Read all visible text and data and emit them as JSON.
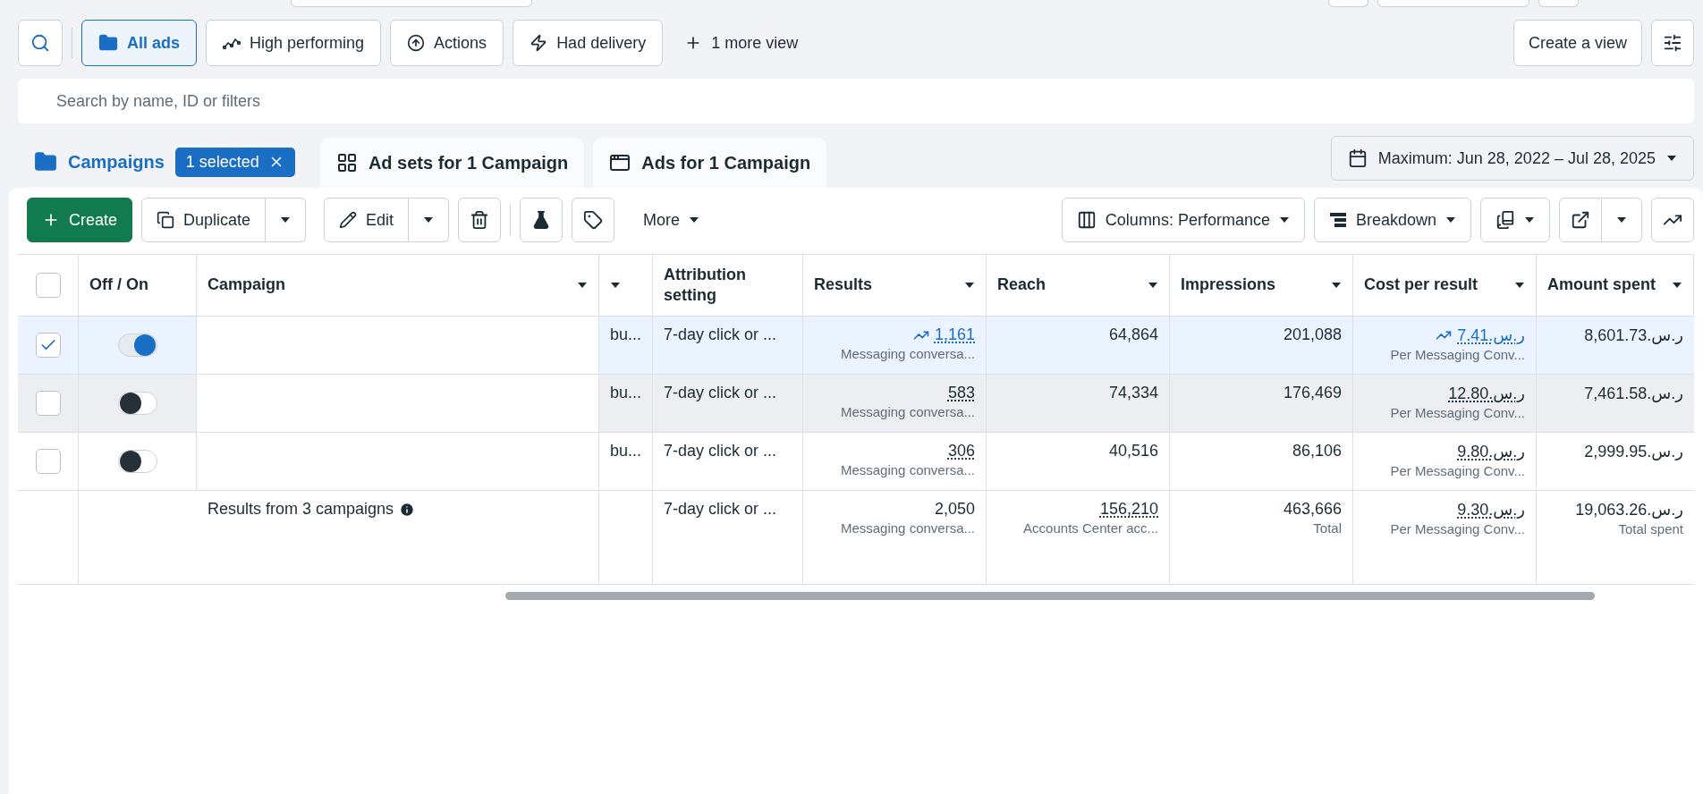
{
  "views": [
    {
      "kind": "search",
      "selected": false
    },
    {
      "kind": "folder",
      "label": "All ads",
      "selected": true
    },
    {
      "kind": "spark",
      "label": "High performing",
      "selected": false
    },
    {
      "kind": "arrow-up",
      "label": "Actions",
      "selected": false
    },
    {
      "kind": "bolt",
      "label": "Had delivery",
      "selected": false
    }
  ],
  "more_view": "1 more view",
  "create_view": "Create a view",
  "search": {
    "placeholder": "Search by name, ID or filters"
  },
  "level_tabs": [
    {
      "kind": "campaigns",
      "label": "Campaigns",
      "selected": true,
      "badge": "1 selected"
    },
    {
      "kind": "adsets",
      "label": "Ad sets for 1 Campaign",
      "selected": false
    },
    {
      "kind": "ads",
      "label": "Ads for 1 Campaign",
      "selected": false
    }
  ],
  "date_range": "Maximum: Jun 28, 2022 – Jul 28, 2025",
  "toolbar": {
    "create": "Create",
    "duplicate": "Duplicate",
    "edit": "Edit",
    "more": "More",
    "columns": "Columns: Performance",
    "breakdown": "Breakdown"
  },
  "all_selected": false,
  "columns": [
    {
      "label": "Off / On",
      "sortable": false
    },
    {
      "label": "Campaign",
      "sortable": true
    },
    {
      "sortable": true
    },
    {
      "label": "Attribution setting",
      "sortable": false
    },
    {
      "label": "Results",
      "sortable": true
    },
    {
      "label": "Reach",
      "sortable": true
    },
    {
      "label": "Impressions",
      "sortable": true
    },
    {
      "label": "Cost per result",
      "sortable": true
    },
    {
      "label": "Amount spent",
      "sortable": true
    }
  ],
  "rows": [
    {
      "selected": true,
      "on": true,
      "hovered": false,
      "delivery": "bu...",
      "attribution": "7-day click or ...",
      "results": {
        "value": "1,161",
        "trend": true,
        "sub": "Messaging conversa..."
      },
      "reach": "64,864",
      "impressions": "201,088",
      "cost": {
        "value": "7.41.ر.س",
        "trend": true,
        "sub": "Per Messaging Conv..."
      },
      "amount": "8,601.73.ر.س"
    },
    {
      "selected": false,
      "on": false,
      "hovered": true,
      "delivery": "bu...",
      "attribution": "7-day click or ...",
      "results": {
        "value": "583",
        "trend": false,
        "sub": "Messaging conversa..."
      },
      "reach": "74,334",
      "impressions": "176,469",
      "cost": {
        "value": "12.80.ر.س",
        "trend": false,
        "sub": "Per Messaging Conv..."
      },
      "amount": "7,461.58.ر.س"
    },
    {
      "selected": false,
      "on": false,
      "hovered": false,
      "delivery": "bu...",
      "attribution": "7-day click or ...",
      "results": {
        "value": "306",
        "trend": false,
        "sub": "Messaging conversa..."
      },
      "reach": "40,516",
      "impressions": "86,106",
      "cost": {
        "value": "9.80.ر.س",
        "trend": false,
        "sub": "Per Messaging Conv..."
      },
      "amount": "2,999.95.ر.س"
    }
  ],
  "totals": {
    "label": "Results from 3 campaigns",
    "attribution": "7-day click or ...",
    "results": {
      "value": "2,050",
      "sub": "Messaging conversa..."
    },
    "reach": {
      "value": "156,210",
      "sub": "Accounts Center acc..."
    },
    "impressions": {
      "value": "463,666",
      "sub": "Total"
    },
    "cost": {
      "value": "9.30.ر.س",
      "sub": "Per Messaging Conv..."
    },
    "amount": {
      "value": "19,063.26.ر.س",
      "sub": "Total spent"
    }
  }
}
